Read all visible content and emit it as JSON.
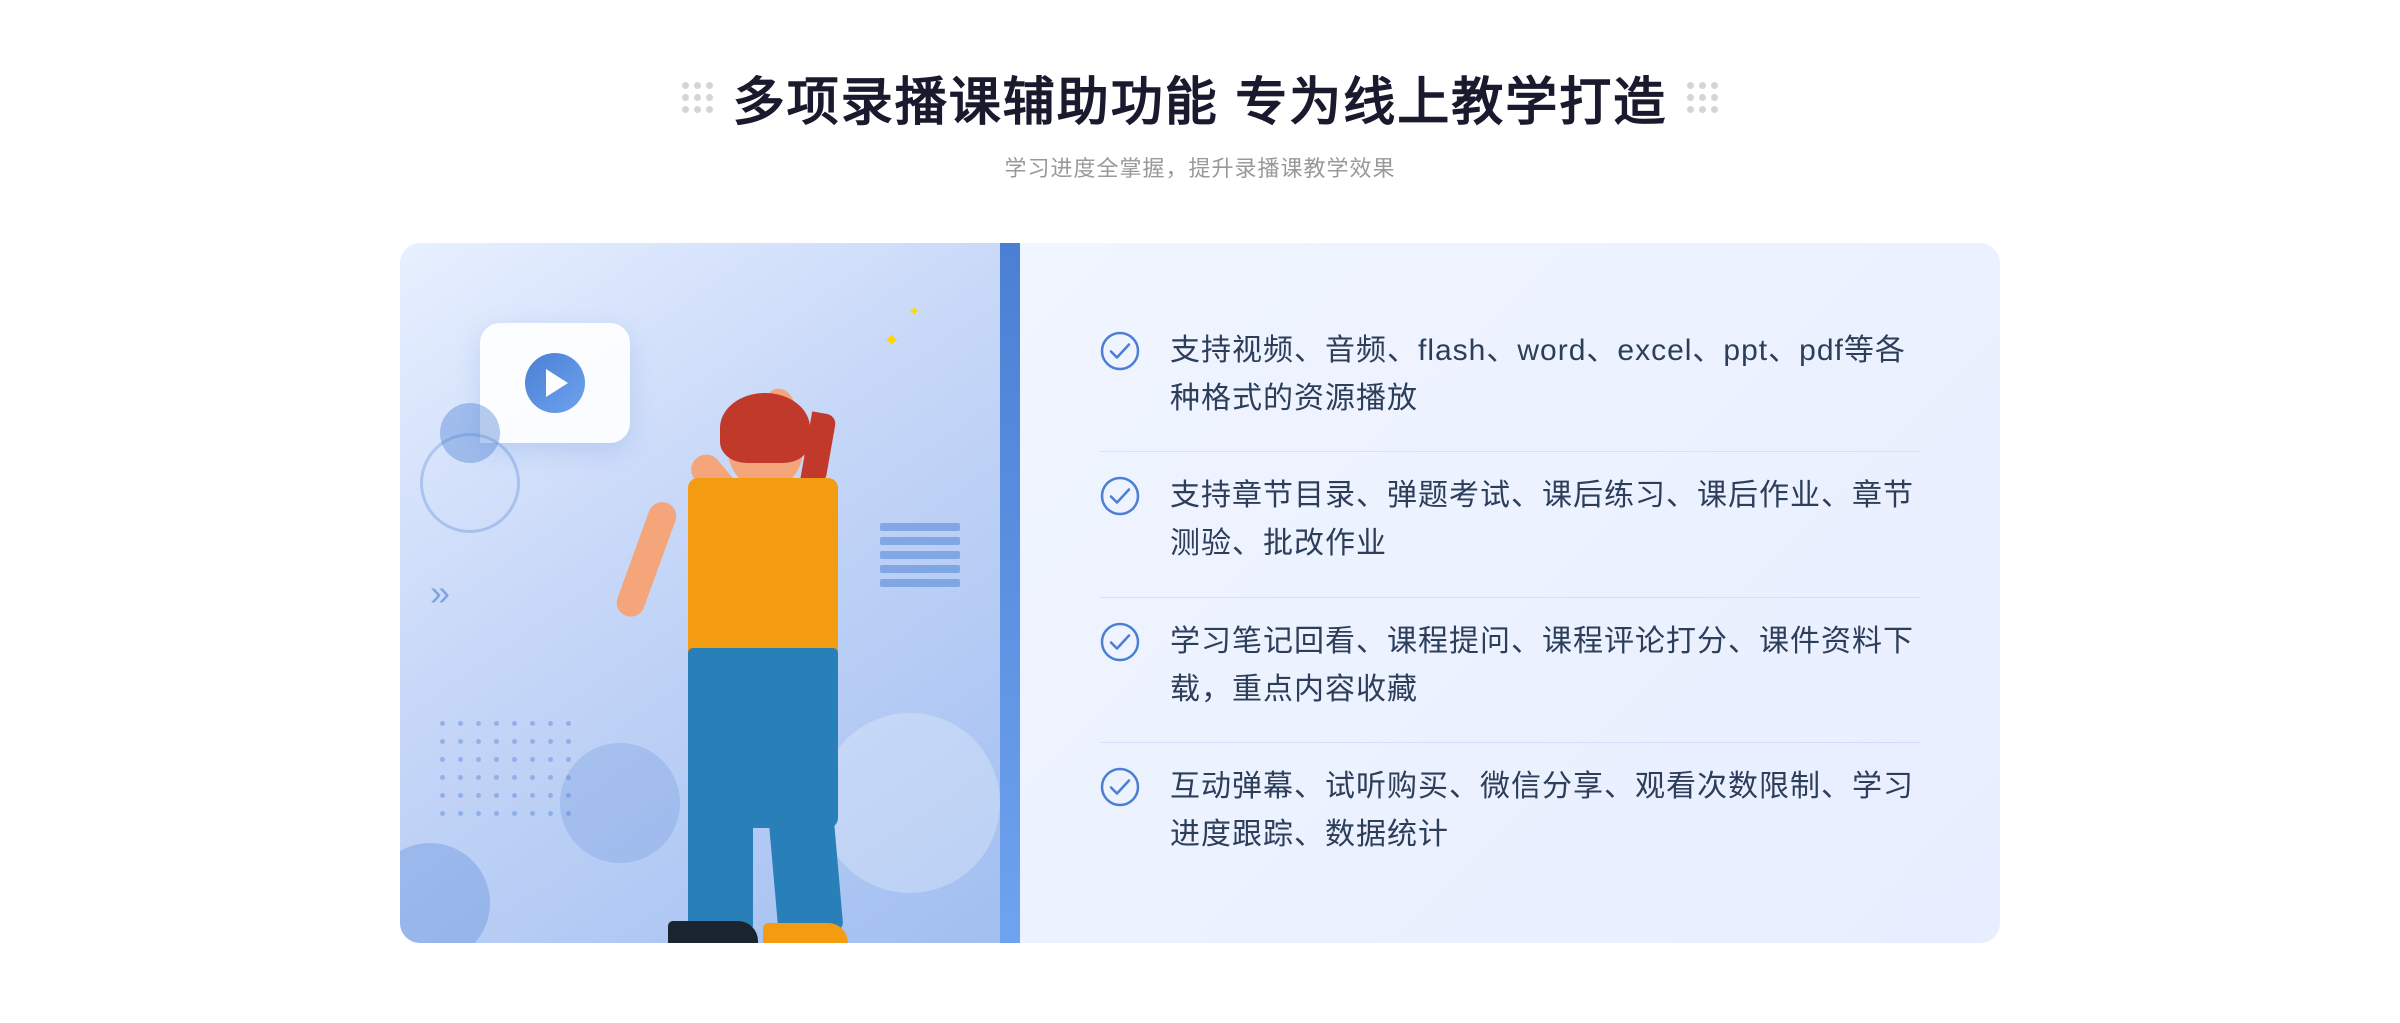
{
  "page": {
    "background": "#ffffff"
  },
  "header": {
    "title": "多项录播课辅助功能 专为线上教学打造",
    "subtitle": "学习进度全掌握，提升录播课教学效果",
    "title_dots_left": "decoration",
    "title_dots_right": "decoration"
  },
  "features": [
    {
      "id": 1,
      "text": "支持视频、音频、flash、word、excel、ppt、pdf等各种格式的资源播放"
    },
    {
      "id": 2,
      "text": "支持章节目录、弹题考试、课后练习、课后作业、章节测验、批改作业"
    },
    {
      "id": 3,
      "text": "学习笔记回看、课程提问、课程评论打分、课件资料下载，重点内容收藏"
    },
    {
      "id": 4,
      "text": "互动弹幕、试听购买、微信分享、观看次数限制、学习进度跟踪、数据统计"
    }
  ],
  "check_icon_color": "#4a7fd4",
  "decorations": {
    "chevrons": "»",
    "play_button": "play",
    "dots_pattern": "grid"
  }
}
